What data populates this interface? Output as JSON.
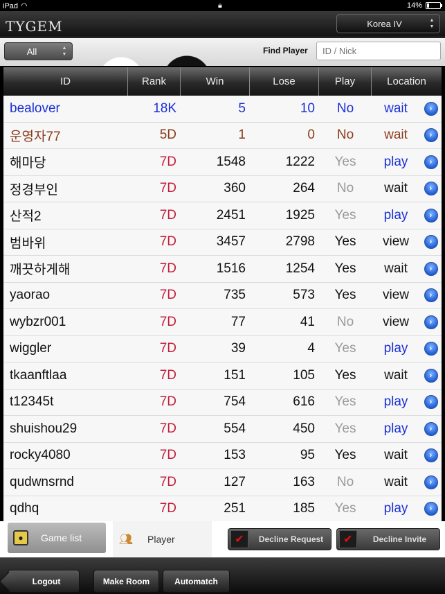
{
  "status": {
    "device": "iPad",
    "battery": "14%"
  },
  "header": {
    "logo": "TYGEM",
    "server": "Korea IV"
  },
  "filter": {
    "all_label": "All",
    "find_label": "Find Player",
    "find_placeholder": "ID / Nick"
  },
  "table": {
    "columns": [
      "ID",
      "Rank",
      "Win",
      "Lose",
      "Play",
      "Location"
    ],
    "rows": [
      {
        "id": "bealover",
        "rank": "18K",
        "win": "5",
        "lose": "10",
        "play": "No",
        "location": "wait",
        "kind": "self"
      },
      {
        "id": "운영자77",
        "rank": "5D",
        "win": "1",
        "lose": "0",
        "play": "No",
        "location": "wait",
        "kind": "admin"
      },
      {
        "id": "해마당",
        "rank": "7D",
        "win": "1548",
        "lose": "1222",
        "play": "Yes",
        "location": "play",
        "kind": "normal"
      },
      {
        "id": "정경부인",
        "rank": "7D",
        "win": "360",
        "lose": "264",
        "play": "No",
        "location": "wait",
        "kind": "normal"
      },
      {
        "id": "산적2",
        "rank": "7D",
        "win": "2451",
        "lose": "1925",
        "play": "Yes",
        "location": "play",
        "kind": "normal"
      },
      {
        "id": "범바위",
        "rank": "7D",
        "win": "3457",
        "lose": "2798",
        "play": "Yes",
        "location": "view",
        "kind": "normal"
      },
      {
        "id": "깨끗하게해",
        "rank": "7D",
        "win": "1516",
        "lose": "1254",
        "play": "Yes",
        "location": "wait",
        "kind": "normal"
      },
      {
        "id": "yaorao",
        "rank": "7D",
        "win": "735",
        "lose": "573",
        "play": "Yes",
        "location": "view",
        "kind": "normal"
      },
      {
        "id": "wybzr001",
        "rank": "7D",
        "win": "77",
        "lose": "41",
        "play": "No",
        "location": "view",
        "kind": "normal"
      },
      {
        "id": "wiggler",
        "rank": "7D",
        "win": "39",
        "lose": "4",
        "play": "Yes",
        "location": "play",
        "kind": "normal"
      },
      {
        "id": "tkaanftlaa",
        "rank": "7D",
        "win": "151",
        "lose": "105",
        "play": "Yes",
        "location": "wait",
        "kind": "normal"
      },
      {
        "id": "t12345t",
        "rank": "7D",
        "win": "754",
        "lose": "616",
        "play": "Yes",
        "location": "play",
        "kind": "normal"
      },
      {
        "id": "shuishou29",
        "rank": "7D",
        "win": "554",
        "lose": "450",
        "play": "Yes",
        "location": "play",
        "kind": "normal"
      },
      {
        "id": "rocky4080",
        "rank": "7D",
        "win": "153",
        "lose": "95",
        "play": "Yes",
        "location": "wait",
        "kind": "normal"
      },
      {
        "id": "qudwnsrnd",
        "rank": "7D",
        "win": "127",
        "lose": "163",
        "play": "No",
        "location": "wait",
        "kind": "normal"
      },
      {
        "id": "qdhq",
        "rank": "7D",
        "win": "251",
        "lose": "185",
        "play": "Yes",
        "location": "play",
        "kind": "normal"
      }
    ]
  },
  "tabs": {
    "game_list": "Game list",
    "player": "Player",
    "decline_request": "Decline Request",
    "decline_invite": "Decline Invite"
  },
  "toolbar": {
    "logout": "Logout",
    "make_room": "Make Room",
    "automatch": "Automatch"
  },
  "colors": {
    "rank_red": "#c31e3c",
    "self_blue": "#1a2fd6",
    "admin_brown": "#8b3a1a",
    "play_link_blue": "#1a2fd6"
  },
  "icons": {
    "go": "chevron-right-circle-icon",
    "checkbox": "red-check-icon",
    "game_list": "go-board-icon",
    "player": "players-icon"
  }
}
